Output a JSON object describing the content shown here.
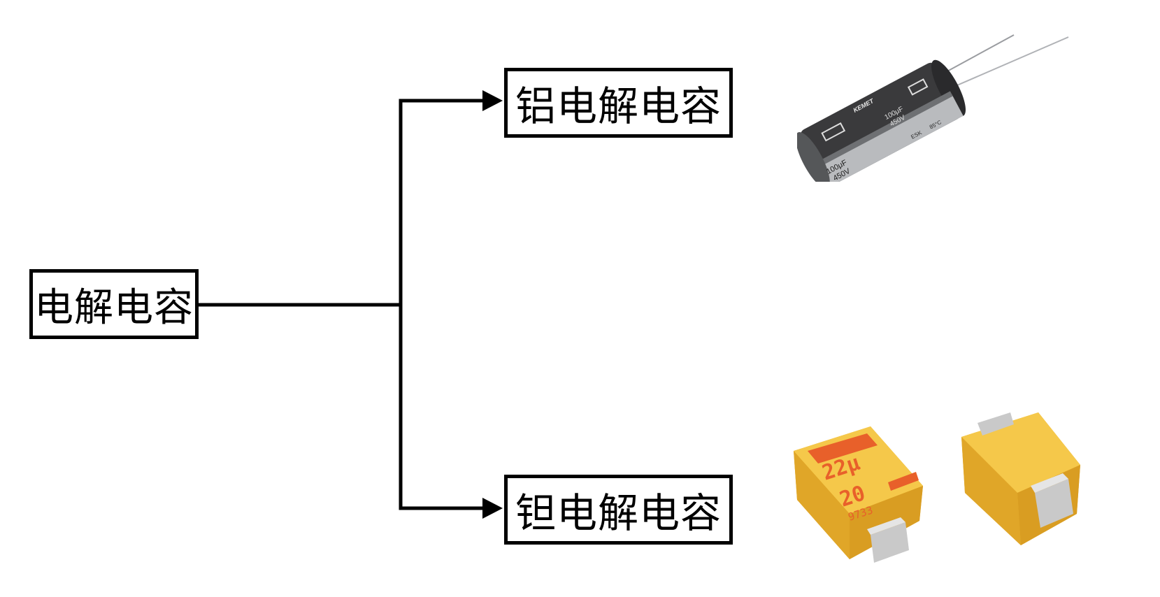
{
  "diagram": {
    "root": {
      "label": "电解电容"
    },
    "children": [
      {
        "label": "铝电解电容"
      },
      {
        "label": "钽电解电容"
      }
    ]
  },
  "images": {
    "aluminum_capacitor": {
      "brand_text": "KEMET",
      "capacitance": "100μF",
      "voltage": "450V",
      "series": "ESK",
      "temperature": "85°C",
      "body_color": "#3a3a3c",
      "sleeve_color": "#b9bbbe"
    },
    "tantalum_capacitor": {
      "capacitance_mark": "22μ",
      "voltage_code": "20",
      "date_code": "9733",
      "body_color": "#f2c23a",
      "marking_color": "#e8602a",
      "terminal_color": "#c9c9c9"
    }
  },
  "colors": {
    "line": "#000000",
    "box_border": "#000000",
    "background": "#ffffff"
  }
}
